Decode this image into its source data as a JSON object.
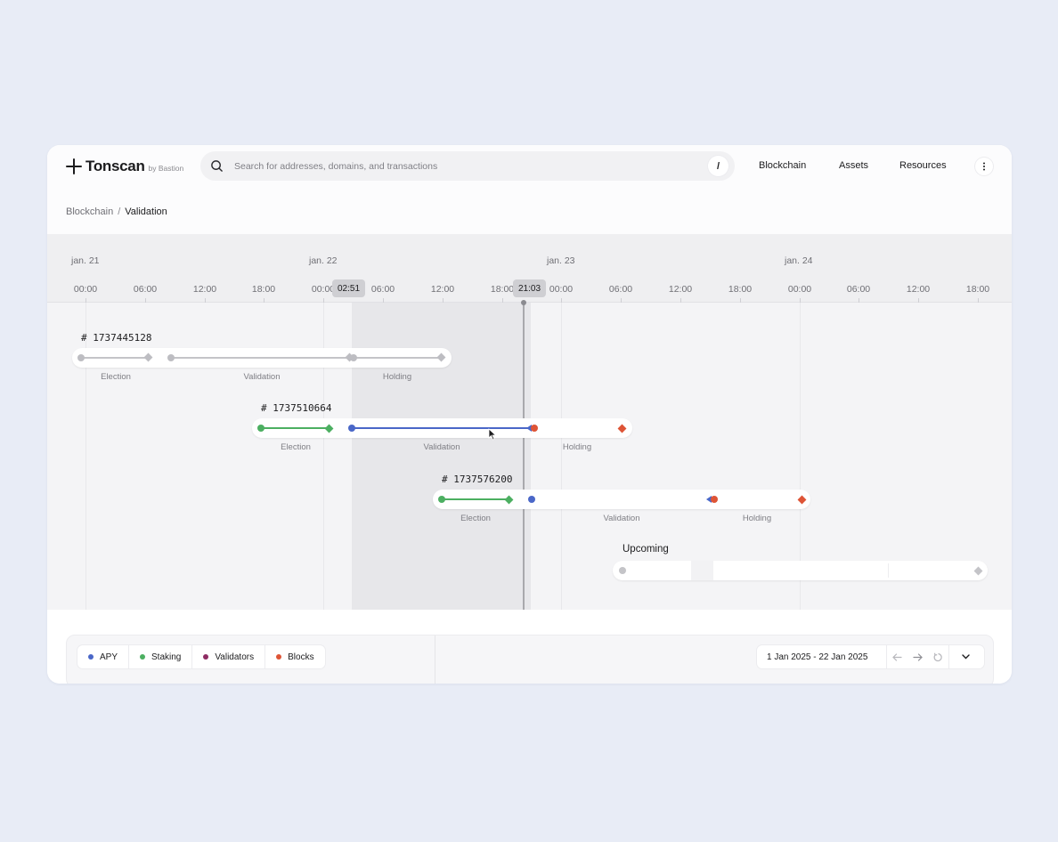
{
  "app": {
    "name": "Tonscan",
    "byline": "by Bastion"
  },
  "search": {
    "placeholder": "Search for addresses, domains, and transactions",
    "shortcut": "/"
  },
  "nav": {
    "items": [
      "Blockchain",
      "Assets",
      "Resources"
    ]
  },
  "breadcrumb": {
    "parent": "Blockchain",
    "separator": "/",
    "current": "Validation"
  },
  "timeline": {
    "days": [
      "jan. 21",
      "jan. 22",
      "jan. 23",
      "jan. 24"
    ],
    "hours": [
      "00:00",
      "06:00",
      "12:00",
      "18:00",
      "00:00",
      "06:00",
      "12:00",
      "18:00",
      "00:00",
      "06:00",
      "12:00",
      "18:00",
      "00:00",
      "06:00",
      "12:00",
      "18:00"
    ],
    "selection_start_badge": "02:51",
    "cursor_badge": "21:03",
    "phases": [
      "Election",
      "Validation",
      "Holding"
    ],
    "cycles": [
      {
        "id": "# 1737445128",
        "status": "completed"
      },
      {
        "id": "# 1737510664",
        "status": "active"
      },
      {
        "id": "# 1737576200",
        "status": "next"
      }
    ],
    "upcoming_label": "Upcoming"
  },
  "legend": {
    "items": [
      {
        "label": "APY",
        "color": "#4a67c8"
      },
      {
        "label": "Staking",
        "color": "#4caf61"
      },
      {
        "label": "Validators",
        "color": "#8e2c63"
      },
      {
        "label": "Blocks",
        "color": "#de5436"
      }
    ]
  },
  "range": {
    "label": "1 Jan 2025 - 22 Jan 2025",
    "prev_icon": "arrow-left-icon",
    "next_icon": "arrow-right-icon",
    "reset_icon": "reset-icon",
    "dropdown_icon": "chevron-down-icon"
  },
  "colors": {
    "election": "#4caf61",
    "validation": "#4a67c8",
    "holding": "#de5436",
    "inactive": "#b9b9be"
  }
}
